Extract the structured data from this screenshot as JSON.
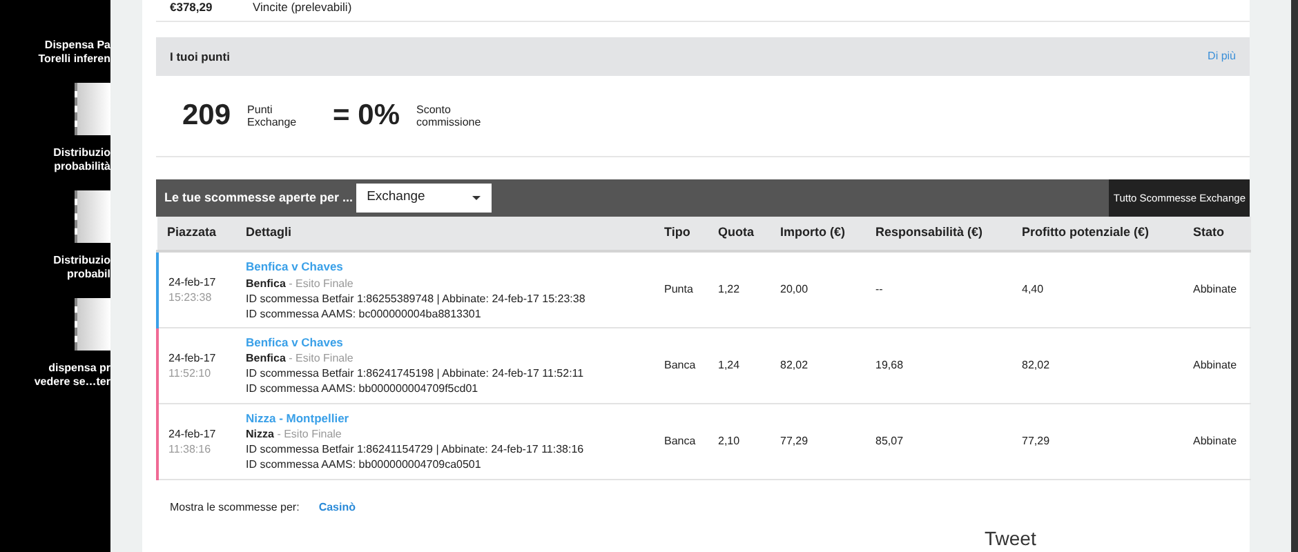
{
  "desktop_icons": [
    {
      "label": "Dispensa Pa\nTorelli inferen"
    },
    {
      "label": "Distribuzio\nprobabilità"
    },
    {
      "label": "Distribuzio\nprobabil"
    },
    {
      "label": "dispensa pr\nvedere se…ter"
    }
  ],
  "balance": {
    "amount": "€378,29",
    "label": "Vincite (prelevabili)"
  },
  "points": {
    "title": "I tuoi punti",
    "link": "Di più",
    "value": "209",
    "value_label": "Punti Exchange",
    "discount": "= 0%",
    "discount_label": "Sconto commissione"
  },
  "bets": {
    "title": "Le tue scommesse aperte per ...",
    "filter": "Exchange",
    "all_button": "Tutto Scommesse Exchange",
    "columns": [
      "Piazzata",
      "Dettagli",
      "Tipo",
      "Quota",
      "Importo (€)",
      "Responsabilità (€)",
      "Profitto potenziale (€)",
      "Stato"
    ],
    "rows": [
      {
        "color": "#3aa0e8",
        "date": "24-feb-17",
        "time": "15:23:38",
        "event": "Benfica v Chaves",
        "selection": "Benfica",
        "market": "- Esito Finale",
        "betfair_id": "ID scommessa Betfair 1:86255389748 | Abbinate: 24-feb-17 15:23:38",
        "aams_id": "ID scommessa AAMS: bc000000004ba8813301",
        "tipo": "Punta",
        "quota": "1,22",
        "importo": "20,00",
        "responsabilita": "--",
        "profitto": "4,40",
        "stato": "Abbinate"
      },
      {
        "color": "#f06a95",
        "date": "24-feb-17",
        "time": "11:52:10",
        "event": "Benfica v Chaves",
        "selection": "Benfica",
        "market": "- Esito Finale",
        "betfair_id": "ID scommessa Betfair 1:86241745198 | Abbinate: 24-feb-17 11:52:11",
        "aams_id": "ID scommessa AAMS: bb000000004709f5cd01",
        "tipo": "Banca",
        "quota": "1,24",
        "importo": "82,02",
        "responsabilita": "19,68",
        "profitto": "82,02",
        "stato": "Abbinate"
      },
      {
        "color": "#f06a95",
        "date": "24-feb-17",
        "time": "11:38:16",
        "event": "Nizza - Montpellier",
        "selection": "Nizza",
        "market": "- Esito Finale",
        "betfair_id": "ID scommessa Betfair 1:86241154729 | Abbinate: 24-feb-17 11:38:16",
        "aams_id": "ID scommessa AAMS: bb000000004709ca0501",
        "tipo": "Banca",
        "quota": "2,10",
        "importo": "77,29",
        "responsabilita": "85,07",
        "profitto": "77,29",
        "stato": "Abbinate"
      }
    ]
  },
  "footer": {
    "label": "Mostra le scommesse per:",
    "link": "Casinò",
    "tweet": "Tweet"
  }
}
